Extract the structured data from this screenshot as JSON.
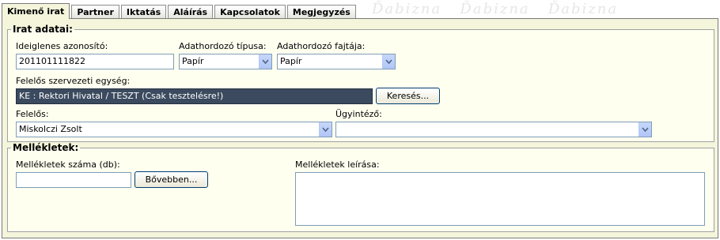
{
  "tabs": [
    {
      "label": "Kimenő irat",
      "active": true
    },
    {
      "label": "Partner",
      "active": false
    },
    {
      "label": "Iktatás",
      "active": false
    },
    {
      "label": "Aláírás",
      "active": false
    },
    {
      "label": "Kapcsolatok",
      "active": false
    },
    {
      "label": "Megjegyzés",
      "active": false
    }
  ],
  "irat": {
    "legend": "Irat adatai:",
    "ideiglenes_label": "Ideiglenes azonosító:",
    "ideiglenes_value": "201101111822",
    "adathordozo_tipus_label": "Adathordozó típusa:",
    "adathordozo_tipus_value": "Papír",
    "adathordozo_fajta_label": "Adathordozó fajtája:",
    "adathordozo_fajta_value": "Papír",
    "felelos_egyseg_label": "Felelős szervezeti egység:",
    "felelos_egyseg_value": "KE : Rektori Hivatal / TESZT (Csak tesztelésre!)",
    "kereses_button": "Keresés...",
    "felelos_label": "Felelős:",
    "felelos_value": "Miskolczi Zsolt",
    "ugyintezo_label": "Ügyintéző:",
    "ugyintezo_value": ""
  },
  "mellekletek": {
    "legend": "Mellékletek:",
    "szam_label": "Mellékletek száma (db):",
    "szam_value": "",
    "bovebben_button": "Bővebben...",
    "leiras_label": "Mellékletek leírása:",
    "leiras_value": ""
  },
  "colors": {
    "panel_bg": "#f5f5dc",
    "fieldset_bg": "#fffff0",
    "selected_field_bg": "#3b4a5e"
  },
  "icons": {
    "dropdown": "chevron-down-icon"
  }
}
